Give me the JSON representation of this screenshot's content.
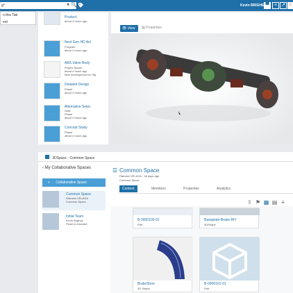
{
  "topbar": {
    "search_value": "g*",
    "clear_glyph": "✖",
    "search_icon": "🔍",
    "user": "Kevin BRIGHEY"
  },
  "dropdown": {
    "items": [
      "n this Tab",
      "ent"
    ]
  },
  "recent_list": [
    {
      "title": "Product",
      "sub1": "Product",
      "sub2": "about 4 hours ago",
      "icon": "product"
    },
    {
      "title": "Next Gen HD Axl",
      "sub1": "Program",
      "sub2": "about 4 hours ago",
      "icon": "program"
    },
    {
      "title": "ABS Valve Body",
      "sub1": "Project Space",
      "sub2": "about 4 hours ago",
      "sub3": "New development for Hig",
      "icon": "project"
    },
    {
      "title": "Detailed Design",
      "sub1": "Phase",
      "sub2": "about 4 hours ago",
      "icon": "phase"
    },
    {
      "title": "Alternative Selec",
      "sub1": "Gate",
      "sub2": "Phase",
      "sub3": "about 4 hours ago",
      "icon": "phase"
    },
    {
      "title": "Concept Study",
      "sub1": "Phase",
      "sub2": "about 4 hours ago",
      "icon": "phase"
    }
  ],
  "viewer": {
    "view_label": "View",
    "properties_label": "Properties"
  },
  "space_panel": {
    "header": "3DSpace - Common Space",
    "my_spaces": "My Collaborative Spaces",
    "collab_btn": "Collaborative Space",
    "spaces": [
      {
        "name": "Common Space",
        "owner": "Ramesh VELAGA",
        "desc": "Common Space"
      },
      {
        "name": "Initial Team",
        "owner": "Kevin Brighey",
        "desc": "Place to innovate"
      }
    ]
  },
  "main_space": {
    "title": "Common Space",
    "owner_line": "Ramesh VELAGA · 46 days ago",
    "desc": "Common Space",
    "tabs": [
      "Content",
      "Members",
      "Properties",
      "Analytics"
    ],
    "cards": [
      {
        "name": "B-0000100-01",
        "type": "Part"
      },
      {
        "name": "Baseplate-Brake-RH",
        "type": "3DShape"
      },
      {
        "name": "BrakeShoe",
        "type": "3D Shape"
      },
      {
        "name": "B-0000101-01",
        "type": "Part"
      }
    ]
  },
  "colors": {
    "accent": "#1f6fa8",
    "button_blue": "#4a9fd6"
  }
}
